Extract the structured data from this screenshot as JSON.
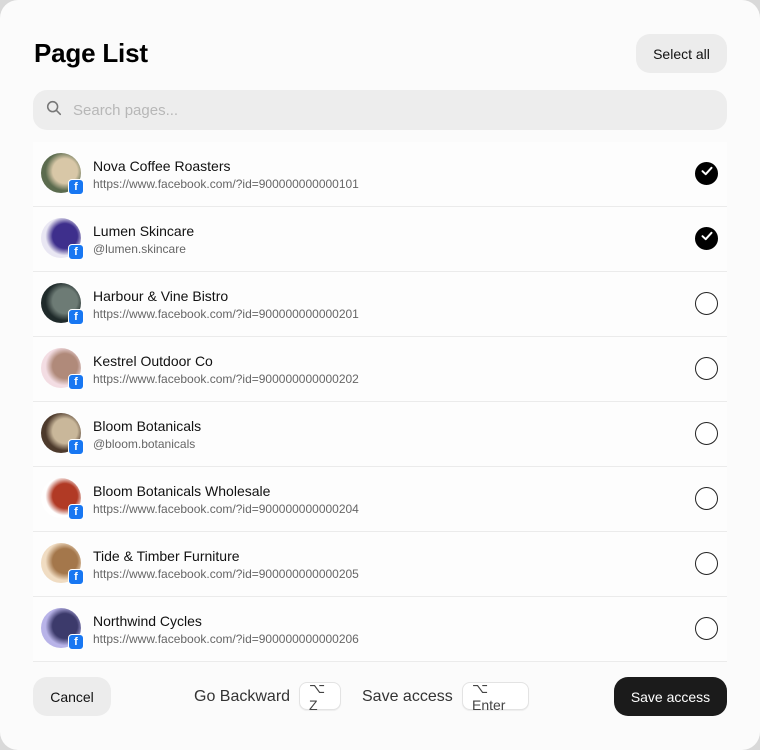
{
  "header": {
    "title": "Page List",
    "select_all_label": "Select all"
  },
  "search": {
    "placeholder": "Search pages...",
    "value": ""
  },
  "pages": [
    {
      "name": "Nova Coffee Roasters",
      "sub": "https://www.facebook.com/?id=900000000000101",
      "checked": true,
      "badge": "f",
      "avatar_colors": [
        "#5b6b4e",
        "#d8c7a7"
      ]
    },
    {
      "name": "Lumen Skincare",
      "sub": "@lumen.skincare",
      "checked": true,
      "badge": "f",
      "avatar_colors": [
        "#e9e7f3",
        "#3e2f8c"
      ]
    },
    {
      "name": "Harbour & Vine Bistro",
      "sub": "https://www.facebook.com/?id=900000000000201",
      "checked": false,
      "badge": "f",
      "avatar_colors": [
        "#1f2a2a",
        "#6d7b75"
      ]
    },
    {
      "name": "Kestrel Outdoor Co",
      "sub": "https://www.facebook.com/?id=900000000000202",
      "checked": false,
      "badge": "f",
      "avatar_colors": [
        "#f3dde3",
        "#b08a7a"
      ]
    },
    {
      "name": "Bloom Botanicals",
      "sub": "@bloom.botanicals",
      "checked": false,
      "badge": "f",
      "avatar_colors": [
        "#4d3a2c",
        "#c9b79a"
      ]
    },
    {
      "name": "Bloom Botanicals Wholesale",
      "sub": "https://www.facebook.com/?id=900000000000204",
      "checked": false,
      "badge": "f",
      "avatar_colors": [
        "#ffffff",
        "#b13a25"
      ]
    },
    {
      "name": "Tide & Timber Furniture",
      "sub": "https://www.facebook.com/?id=900000000000205",
      "checked": false,
      "badge": "f",
      "avatar_colors": [
        "#f0dcc2",
        "#a4774b"
      ]
    },
    {
      "name": "Northwind Cycles",
      "sub": "https://www.facebook.com/?id=900000000000206",
      "checked": false,
      "badge": "f",
      "avatar_colors": [
        "#b8b3e8",
        "#3c3a6b"
      ]
    }
  ],
  "footer": {
    "cancel_label": "Cancel",
    "go_backward_label": "Go Backward",
    "go_backward_shortcut": "⌥ Z",
    "save_hint_label": "Save access",
    "save_hint_shortcut": "⌥ Enter",
    "save_label": "Save access"
  },
  "icons": {
    "search": "search-icon",
    "check": "checkmark-icon",
    "badge": "facebook-badge-icon"
  }
}
